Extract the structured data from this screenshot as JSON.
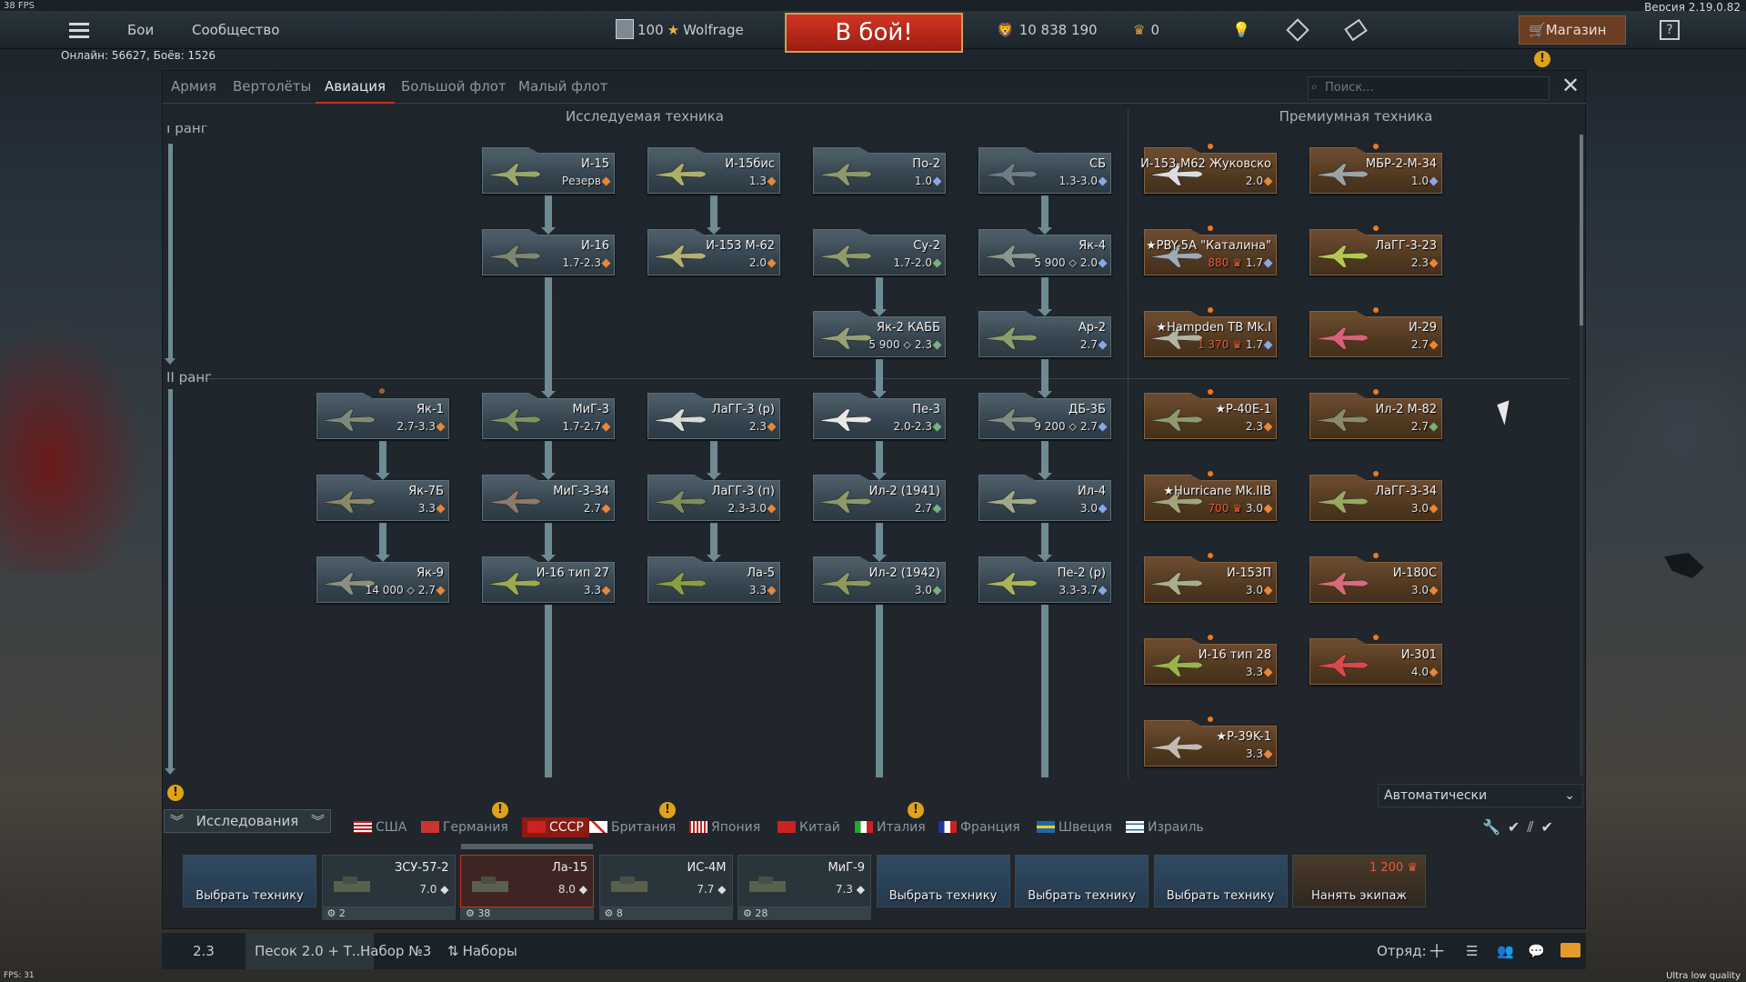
{
  "fps": "38 FPS",
  "version": "Версия 2.19.0.82",
  "topnav": {
    "battles": "Бои",
    "community": "Сообщество"
  },
  "profile": {
    "level": "100",
    "name": "Wolfrage"
  },
  "battle_button": "В бой!",
  "silver": "10 838 190",
  "gold": "0",
  "shop": "Магазин",
  "help": "?",
  "online": "Онлайн: 56627, Боёв: 1526",
  "tabs": [
    "Армия",
    "Вертолёты",
    "Авиация",
    "Большой флот",
    "Малый флот"
  ],
  "search_placeholder": "Поиск...",
  "col_research": "Исследуемая техника",
  "col_premium": "Премиумная техника",
  "rank1": "I ранг",
  "rank2": "II ранг",
  "tree": [
    {
      "name": "И-15",
      "br": "Резерв",
      "cost": "",
      "d": "or"
    },
    {
      "name": "И-15бис",
      "br": "1.3",
      "cost": "",
      "d": "or"
    },
    {
      "name": "По-2",
      "br": "1.0",
      "cost": "",
      "d": "bl"
    },
    {
      "name": "СБ",
      "br": "1.3-3.0",
      "cost": "",
      "d": "bl"
    },
    {
      "name": "И-16",
      "br": "1.7-2.3",
      "cost": "",
      "d": "or"
    },
    {
      "name": "И-153 М-62",
      "br": "2.0",
      "cost": "",
      "d": "or"
    },
    {
      "name": "Су-2",
      "br": "1.7-2.0",
      "cost": "",
      "d": "gr"
    },
    {
      "name": "Як-4",
      "br": "2.0",
      "cost": "5 900",
      "d": "bl"
    },
    {
      "name": "Як-2 КАББ",
      "br": "2.3",
      "cost": "5 900",
      "d": "gr"
    },
    {
      "name": "Ар-2",
      "br": "2.7",
      "cost": "",
      "d": "bl"
    },
    {
      "name": "Як-1",
      "br": "2.7-3.3",
      "cost": "",
      "d": "or"
    },
    {
      "name": "МиГ-3",
      "br": "1.7-2.7",
      "cost": "",
      "d": "or"
    },
    {
      "name": "ЛаГГ-3 (р)",
      "br": "2.3",
      "cost": "",
      "d": "or"
    },
    {
      "name": "Пе-3",
      "br": "2.0-2.3",
      "cost": "",
      "d": "gr"
    },
    {
      "name": "ДБ-3Б",
      "br": "2.7",
      "cost": "9 200",
      "d": "bl"
    },
    {
      "name": "Як-7Б",
      "br": "3.3",
      "cost": "",
      "d": "or"
    },
    {
      "name": "МиГ-3-34",
      "br": "2.7",
      "cost": "",
      "d": "or"
    },
    {
      "name": "ЛаГГ-3 (п)",
      "br": "2.3-3.0",
      "cost": "",
      "d": "or"
    },
    {
      "name": "Ил-2 (1941)",
      "br": "2.7",
      "cost": "",
      "d": "gr"
    },
    {
      "name": "Ил-4",
      "br": "3.0",
      "cost": "",
      "d": "bl"
    },
    {
      "name": "Як-9",
      "br": "2.7",
      "cost": "14 000",
      "d": "or"
    },
    {
      "name": "И-16 тип 27",
      "br": "3.3",
      "cost": "",
      "d": "or"
    },
    {
      "name": "Ла-5",
      "br": "3.3",
      "cost": "",
      "d": "or"
    },
    {
      "name": "Ил-2 (1942)",
      "br": "3.0",
      "cost": "",
      "d": "gr"
    },
    {
      "name": "Пе-2 (р)",
      "br": "3.3-3.7",
      "cost": "",
      "d": "bl"
    }
  ],
  "premium": [
    {
      "name": "И-153-М62 Жуковско",
      "br": "2.0",
      "cost": "",
      "d": "or"
    },
    {
      "name": "МБР-2-М-34",
      "br": "1.0",
      "cost": "",
      "d": "bl"
    },
    {
      "name": "★PBY-5A \"Каталина\"",
      "br": "1.7",
      "cost": "880",
      "d": "bl"
    },
    {
      "name": "ЛаГГ-3-23",
      "br": "2.3",
      "cost": "",
      "d": "or"
    },
    {
      "name": "★Hampden TB Mk.I",
      "br": "1.7",
      "cost": "1 370",
      "d": "bl"
    },
    {
      "name": "И-29",
      "br": "2.7",
      "cost": "",
      "d": "or"
    },
    {
      "name": "★P-40E-1",
      "br": "2.3",
      "cost": "",
      "d": "or"
    },
    {
      "name": "Ил-2 М-82",
      "br": "2.7",
      "cost": "",
      "d": "gr"
    },
    {
      "name": "★Hurricane Mk.IIB",
      "br": "3.0",
      "cost": "700",
      "d": "or"
    },
    {
      "name": "ЛаГГ-3-34",
      "br": "3.0",
      "cost": "",
      "d": "or"
    },
    {
      "name": "И-153П",
      "br": "3.0",
      "cost": "",
      "d": "or"
    },
    {
      "name": "И-180С",
      "br": "3.0",
      "cost": "",
      "d": "or"
    },
    {
      "name": "И-16 тип 28",
      "br": "3.3",
      "cost": "",
      "d": "or"
    },
    {
      "name": "И-301",
      "br": "4.0",
      "cost": "",
      "d": "or"
    },
    {
      "name": "★P-39K-1",
      "br": "3.3",
      "cost": "",
      "d": "or"
    }
  ],
  "auto_select": "Автоматически",
  "research_label": "Исследования",
  "nations": [
    "США",
    "Германия",
    "СССР",
    "Британия",
    "Япония",
    "Китай",
    "Италия",
    "Франция",
    "Швеция",
    "Израиль"
  ],
  "slots": [
    {
      "type": "crew",
      "label": "Выбрать технику"
    },
    {
      "type": "veh",
      "name": "ЗСУ-57-2",
      "br": "7.0",
      "foot": "2"
    },
    {
      "type": "veh",
      "name": "Ла-15",
      "br": "8.0",
      "foot": "38"
    },
    {
      "type": "veh",
      "name": "ИС-4М",
      "br": "7.7",
      "foot": "8"
    },
    {
      "type": "veh",
      "name": "МиГ-9",
      "br": "7.3",
      "foot": "28"
    },
    {
      "type": "crew",
      "label": "Выбрать технику"
    },
    {
      "type": "crew",
      "label": "Выбрать технику"
    },
    {
      "type": "crew",
      "label": "Выбрать технику"
    },
    {
      "type": "hire",
      "label": "Нанять экипаж",
      "cost": "1 200"
    }
  ],
  "bottom": {
    "br": "2.3",
    "mode": "Песок 2.0 + Т...",
    "preset": "Набор №3",
    "presets": "Наборы",
    "squad": "Отряд:"
  },
  "fps_small": "FPS: 31",
  "quality": "Ultra low quality",
  "colors": {
    "accent_red": "#c8301e",
    "premium_bg": "#6a4a2f",
    "card_bg": "#4b5c67",
    "orange_badge": "#e0a218"
  }
}
